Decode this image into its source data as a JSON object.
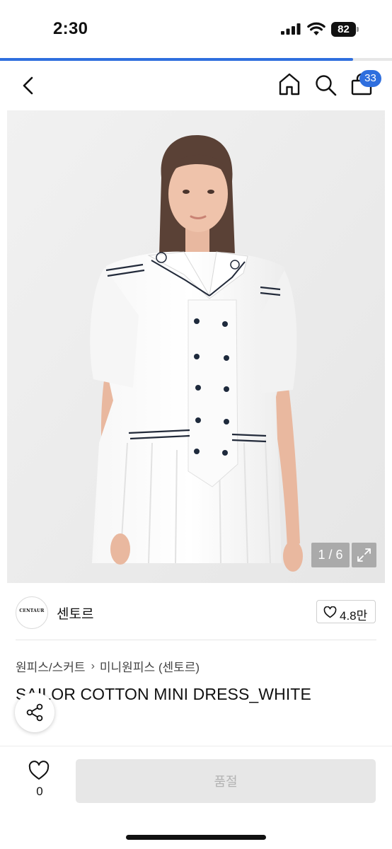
{
  "status_bar": {
    "time": "2:30",
    "battery": "82"
  },
  "loading_progress": 0.9,
  "nav": {
    "icons": [
      "back-icon",
      "home-icon",
      "search-icon",
      "cart-icon"
    ],
    "cart_count": "33"
  },
  "gallery": {
    "pager": "1 / 6",
    "expand_icon": "expand-icon"
  },
  "brand": {
    "logo_text": "CENTAUR",
    "name": "센토르",
    "likes": "4.8만"
  },
  "breadcrumb": {
    "category": "원피스/스커트",
    "separator": "›",
    "subcategory": "미니원피스 (센토르)"
  },
  "product": {
    "title": "SAILOR COTTON MINI DRESS_WHITE"
  },
  "share": {
    "icon": "share-icon"
  },
  "bottom_bar": {
    "wish_count": "0",
    "buy_label": "품절"
  },
  "colors": {
    "accent": "#2f6fde",
    "button_disabled_bg": "#e7e7e7",
    "button_disabled_text": "#b3b3b3"
  }
}
